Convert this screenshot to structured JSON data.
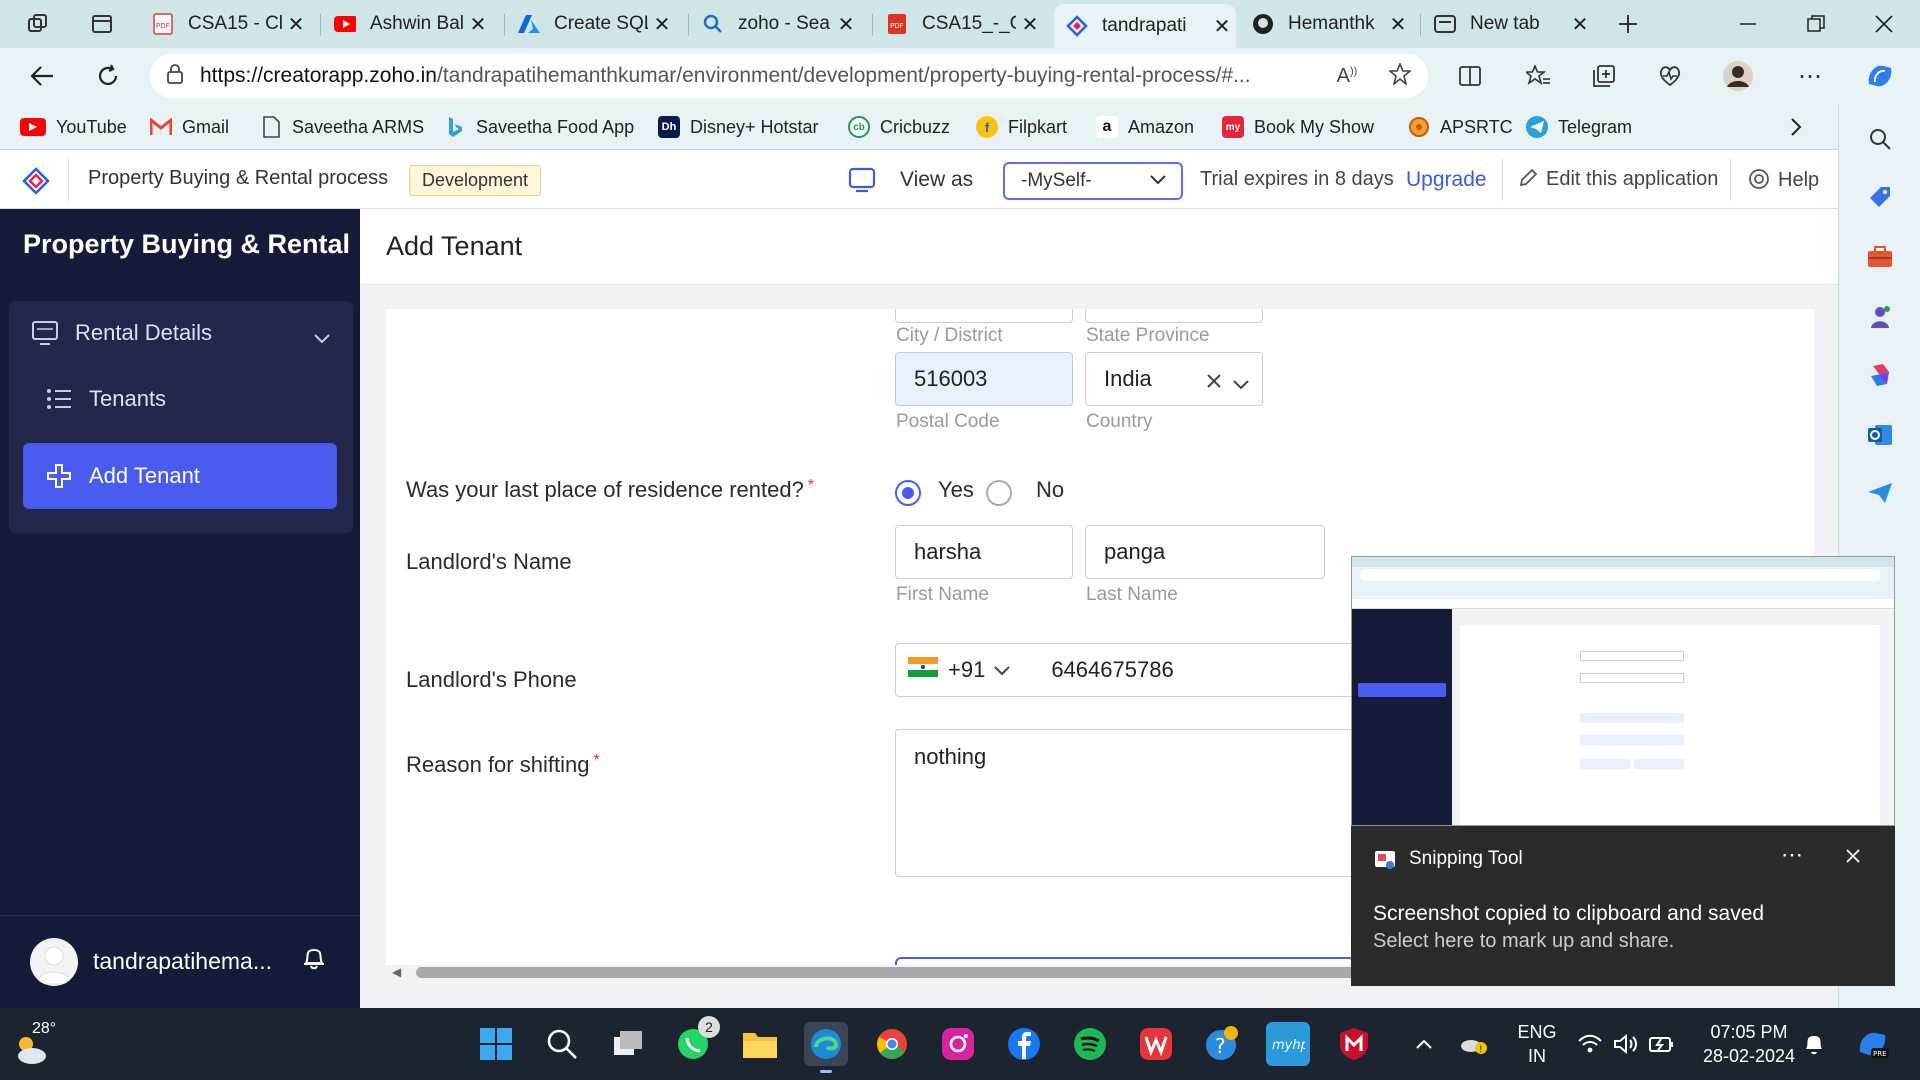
{
  "browser": {
    "tabs": [
      {
        "title": "CSA15 - Cl",
        "icon": "pdf-icon"
      },
      {
        "title": "Ashwin Bal",
        "icon": "youtube-icon"
      },
      {
        "title": "Create SQL",
        "icon": "azure-icon"
      },
      {
        "title": "zoho - Sea",
        "icon": "search-icon"
      },
      {
        "title": "CSA15_-_C",
        "icon": "pdf-icon"
      },
      {
        "title": "tandrapati",
        "icon": "zoho-creator-icon",
        "active": true
      },
      {
        "title": "Hemanthk",
        "icon": "github-icon"
      },
      {
        "title": "New tab",
        "icon": "newtab-icon"
      }
    ],
    "url_host": "https://creatorapp.zoho.in",
    "url_path": "/tandrapatihemanthkumar/environment/development/property-buying-rental-process/#...",
    "bookmarks": [
      {
        "label": "YouTube",
        "icon": "youtube-icon",
        "color": "#ff0000"
      },
      {
        "label": "Gmail",
        "icon": "gmail-icon",
        "color": "#ea4335"
      },
      {
        "label": "Saveetha ARMS",
        "icon": "page-icon",
        "color": "#444444"
      },
      {
        "label": "Saveetha Food App",
        "icon": "bing-icon",
        "color": "#2aa3d8"
      },
      {
        "label": "Disney+ Hotstar",
        "icon": "hotstar-icon",
        "color": "#0c1a4d"
      },
      {
        "label": "Cricbuzz",
        "icon": "cricbuzz-icon",
        "color": "#1b9a59"
      },
      {
        "label": "Filpkart",
        "icon": "flipkart-icon",
        "color": "#f7c600"
      },
      {
        "label": "Amazon",
        "icon": "amazon-icon",
        "color": "#111111"
      },
      {
        "label": "Book My Show",
        "icon": "bookmyshow-icon",
        "color": "#e3263a"
      },
      {
        "label": "APSRTC",
        "icon": "apsrtc-icon",
        "color": "#e86f1c"
      },
      {
        "label": "Telegram",
        "icon": "telegram-icon",
        "color": "#2aa1da"
      }
    ]
  },
  "zoho": {
    "app_name": "Property Buying & Rental process",
    "environment": "Development",
    "view_as_label": "View as",
    "view_as_value": "-MySelf-",
    "trial_text": "Trial expires in 8 days",
    "upgrade_label": "Upgrade",
    "edit_label": "Edit this application",
    "help_label": "Help",
    "brand": "Property Buying & Rental",
    "nav": {
      "section": "Rental Details",
      "items": [
        "Tenants",
        "Add Tenant"
      ],
      "active": "Add Tenant"
    },
    "user_name": "tandrapatihema...",
    "page_title": "Add Tenant"
  },
  "form": {
    "city_label": "City / District",
    "state_label": "State Province",
    "postal_code": "516003",
    "postal_label": "Postal Code",
    "country": "India",
    "country_label": "Country",
    "residence_question": "Was your last place of residence rented?",
    "residence_options": [
      "Yes",
      "No"
    ],
    "residence_selected": "Yes",
    "landlord_name_label": "Landlord's Name",
    "first_name": "harsha",
    "first_name_label": "First Name",
    "last_name": "panga",
    "last_name_label": "Last Name",
    "landlord_phone_label": "Landlord's Phone",
    "phone_code": "+91",
    "phone_number": "6464675786",
    "reason_label": "Reason for shifting",
    "reason_value": "nothing"
  },
  "toast": {
    "app": "Snipping Tool",
    "line1": "Screenshot copied to clipboard and saved",
    "line2": "Select here to mark up and share."
  },
  "taskbar": {
    "temperature": "28°",
    "lang1": "ENG",
    "lang2": "IN",
    "time": "07:05 PM",
    "date": "28-02-2024",
    "whatsapp_badge": "2"
  },
  "colors": {
    "accent": "#4a5cf0",
    "nav_bg": "#171a38",
    "browser_bg": "#e8f1f3",
    "tabstrip_bg": "#cfe5e6"
  }
}
